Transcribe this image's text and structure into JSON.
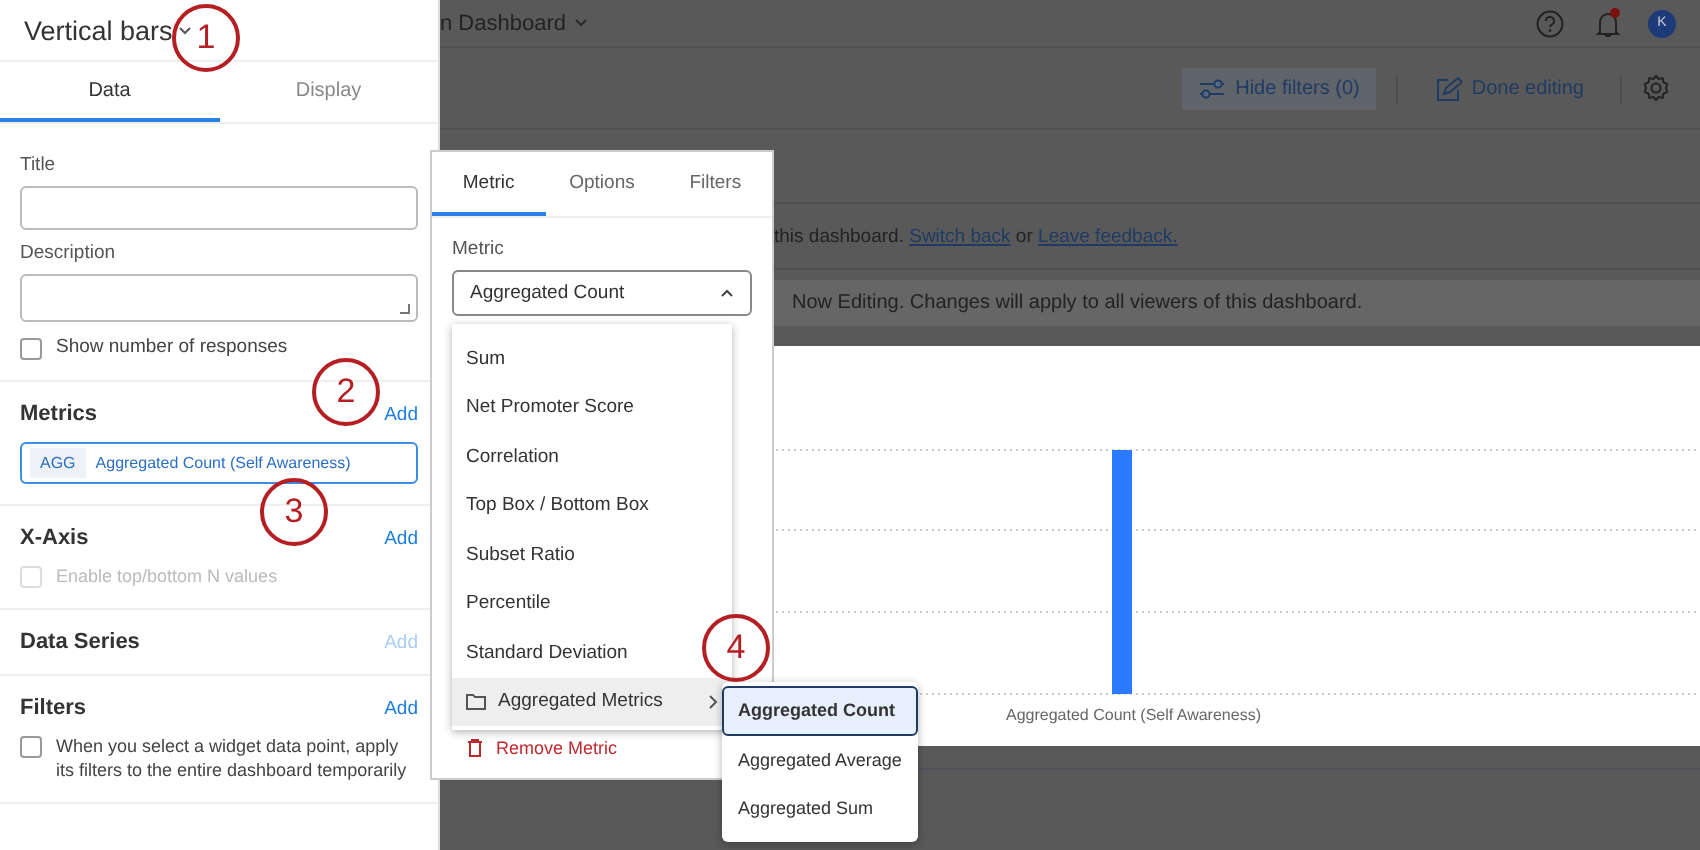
{
  "panel": {
    "title": "Vertical bars",
    "tabs": [
      {
        "label": "Data",
        "selected": true
      },
      {
        "label": "Display",
        "selected": false
      }
    ],
    "fields": [
      {
        "label": "Title",
        "kind": "input"
      },
      {
        "label": "Description",
        "kind": "textarea"
      }
    ],
    "show_responses": {
      "label": "Show number of responses",
      "checked": false
    },
    "sections": [
      {
        "title": "Metrics",
        "add": "Add",
        "add_disabled": false,
        "chips": [
          {
            "tag": "AGG",
            "label": "Aggregated Count (Self Awareness)"
          }
        ]
      },
      {
        "title": "X-Axis",
        "add": "Add",
        "add_disabled": false,
        "options": [
          {
            "label": "Enable top/bottom N values",
            "checked": false,
            "disabled": true
          }
        ]
      },
      {
        "title": "Data Series",
        "add": "Add",
        "add_disabled": true
      },
      {
        "title": "Filters",
        "add": "Add",
        "add_disabled": false,
        "options": [
          {
            "label": "When you select a widget data point, apply its filters to the entire dashboard temporarily",
            "checked": false,
            "disabled": false
          }
        ]
      }
    ]
  },
  "dashboard": {
    "title": "n Dashboard",
    "avatar": "K",
    "toolbar": [
      "Hide filters (0)",
      "Done editing"
    ],
    "notice": {
      "text": "this dashboard.",
      "link_1": "Switch back",
      "joiner": "or",
      "link_2": "Leave feedback."
    },
    "banner": "Now Editing. Changes will apply to all viewers of this dashboard.",
    "chart": {
      "x_label": "Aggregated Count (Self Awareness)"
    }
  },
  "popover": {
    "tabs": [
      {
        "label": "Metric",
        "selected": true
      },
      {
        "label": "Options",
        "selected": false
      },
      {
        "label": "Filters",
        "selected": false
      }
    ],
    "metric_label": "Metric",
    "metric_value": "Aggregated Count",
    "menu": [
      {
        "label": "Sum",
        "kind": "item",
        "selected": false
      },
      {
        "label": "Net Promoter Score",
        "kind": "item",
        "selected": false
      },
      {
        "label": "Correlation",
        "kind": "item",
        "selected": false
      },
      {
        "label": "Top Box / Bottom Box",
        "kind": "item",
        "selected": false
      },
      {
        "label": "Subset Ratio",
        "kind": "item",
        "selected": false
      },
      {
        "label": "Percentile",
        "kind": "item",
        "selected": false
      },
      {
        "label": "Standard Deviation",
        "kind": "item",
        "selected": false
      },
      {
        "label": "Aggregated Metrics",
        "kind": "folder",
        "selected": true
      }
    ],
    "remove": "Remove Metric",
    "submenu": [
      {
        "label": "Aggregated Count",
        "selected": true
      },
      {
        "label": "Aggregated Average",
        "selected": false
      },
      {
        "label": "Aggregated Sum",
        "selected": false
      }
    ]
  },
  "callouts": [
    "1",
    "2",
    "3",
    "4"
  ]
}
